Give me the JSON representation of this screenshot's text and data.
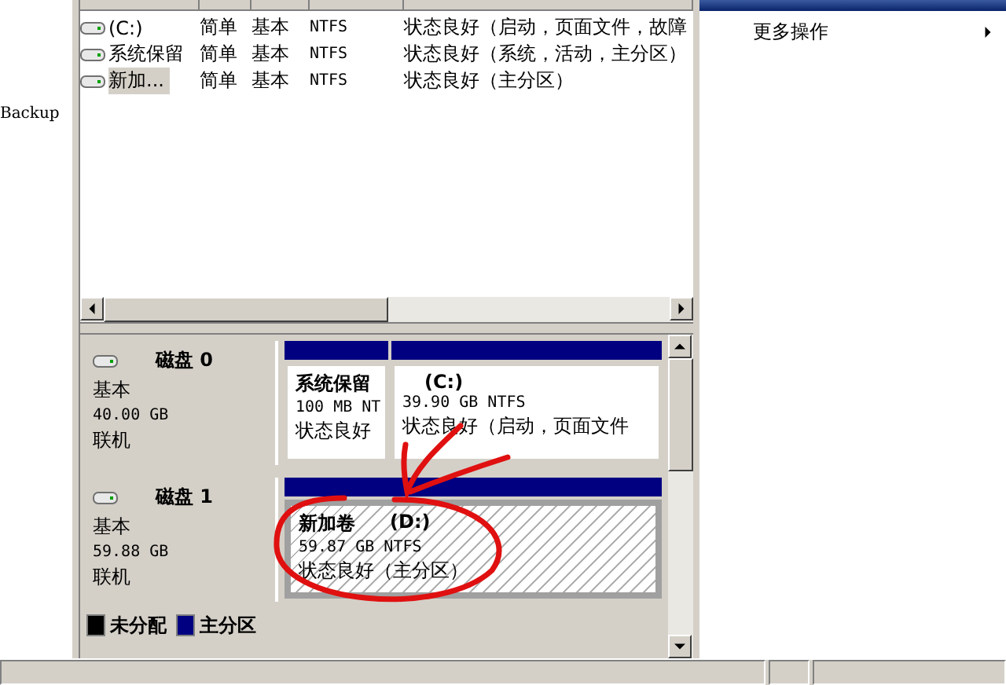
{
  "left_pane": {
    "label": "Backup"
  },
  "volume_list": {
    "rows": [
      {
        "volume": "(C:)",
        "layout": "简单",
        "type": "基本",
        "fs": "NTFS",
        "status": "状态良好（启动，页面文件，故障",
        "selected": false
      },
      {
        "volume": "系统保留",
        "layout": "简单",
        "type": "基本",
        "fs": "NTFS",
        "status": "状态良好（系统，活动，主分区）",
        "selected": false
      },
      {
        "volume": "新加...",
        "layout": "简单",
        "type": "基本",
        "fs": "NTFS",
        "status": "状态良好（主分区）",
        "selected": true
      }
    ]
  },
  "disks": [
    {
      "name": "磁盘 0",
      "type": "基本",
      "size": "40.00 GB",
      "state": "联机",
      "partitions": [
        {
          "name": "系统保留",
          "size": "100 MB NT",
          "status": "状态良好",
          "selected": false
        },
        {
          "letter": "(C:)",
          "size": "39.90 GB NTFS",
          "status": "状态良好（启动，页面文件",
          "selected": false
        }
      ]
    },
    {
      "name": "磁盘 1",
      "type": "基本",
      "size": "59.88 GB",
      "state": "联机",
      "partitions": [
        {
          "name": "新加卷",
          "letter": "(D:)",
          "size": "59.87 GB NTFS",
          "status": "状态良好（主分区）",
          "selected": true
        }
      ]
    }
  ],
  "legend": [
    {
      "label": "未分配",
      "color": "#000000"
    },
    {
      "label": "主分区",
      "color": "#000080"
    }
  ],
  "actions": {
    "items": [
      {
        "label": "更多操作"
      }
    ]
  },
  "watermark_free_annotation": {
    "kind": "red-circle"
  }
}
